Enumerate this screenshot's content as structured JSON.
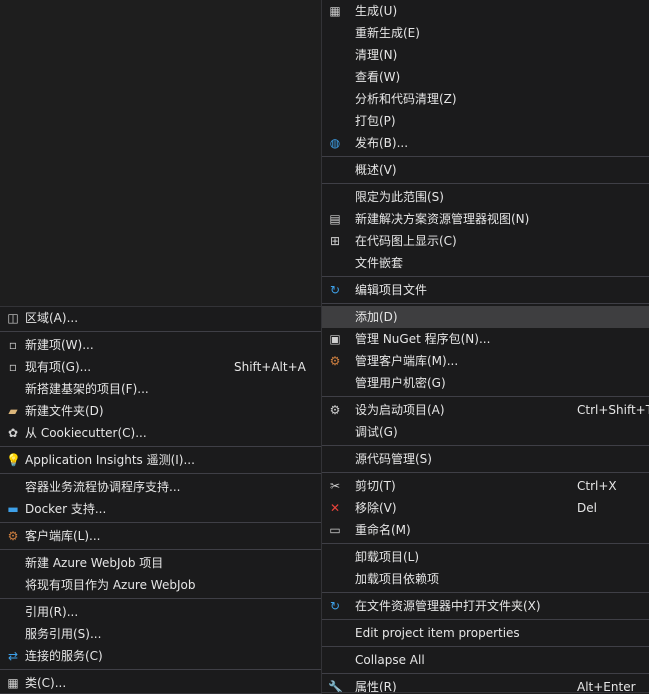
{
  "main_menu": {
    "items": [
      {
        "label": "生成(U)",
        "icon": "build-icon",
        "glyph": "▦",
        "color": "#c8c8c8"
      },
      {
        "label": "重新生成(E)"
      },
      {
        "label": "清理(N)"
      },
      {
        "label": "查看(W)"
      },
      {
        "label": "分析和代码清理(Z)"
      },
      {
        "label": "打包(P)"
      },
      {
        "label": "发布(B)...",
        "icon": "publish-globe-icon",
        "glyph": "◍",
        "color": "#3ea0e8"
      },
      {
        "sep": true
      },
      {
        "label": "概述(V)"
      },
      {
        "sep": true
      },
      {
        "label": "限定为此范围(S)"
      },
      {
        "label": "新建解决方案资源管理器视图(N)",
        "icon": "new-solution-explorer-view-icon",
        "glyph": "▤",
        "color": "#d0d0d0"
      },
      {
        "label": "在代码图上显示(C)",
        "icon": "code-map-icon",
        "glyph": "⊞",
        "color": "#d0d0d0"
      },
      {
        "label": "文件嵌套"
      },
      {
        "sep": true
      },
      {
        "label": "编辑项目文件",
        "icon": "edit-project-file-icon",
        "glyph": "↻",
        "color": "#3ea0e8"
      },
      {
        "sep": true
      },
      {
        "label": "添加(D)",
        "highlighted": true
      },
      {
        "label": "管理 NuGet 程序包(N)...",
        "icon": "nuget-package-icon",
        "glyph": "▣",
        "color": "#d0d0d0"
      },
      {
        "label": "管理客户端库(M)...",
        "icon": "client-library-icon",
        "glyph": "⚙",
        "color": "#d08040"
      },
      {
        "label": "管理用户机密(G)"
      },
      {
        "sep": true
      },
      {
        "label": "设为启动项目(A)",
        "icon": "startup-project-gear-icon",
        "glyph": "⚙",
        "color": "#d0d0d0",
        "shortcut": "Ctrl+Shift+T"
      },
      {
        "label": "调试(G)"
      },
      {
        "sep": true
      },
      {
        "label": "源代码管理(S)"
      },
      {
        "sep": true
      },
      {
        "label": "剪切(T)",
        "icon": "cut-scissors-icon",
        "glyph": "✂",
        "color": "#d0d0d0",
        "shortcut": "Ctrl+X"
      },
      {
        "label": "移除(V)",
        "icon": "remove-x-icon",
        "glyph": "✕",
        "color": "#e8433b",
        "shortcut": "Del"
      },
      {
        "label": "重命名(M)",
        "icon": "rename-icon",
        "glyph": "▭",
        "color": "#d0d0d0"
      },
      {
        "sep": true
      },
      {
        "label": "卸载项目(L)"
      },
      {
        "label": "加载项目依赖项"
      },
      {
        "sep": true
      },
      {
        "label": "在文件资源管理器中打开文件夹(X)",
        "icon": "open-folder-refresh-icon",
        "glyph": "↻",
        "color": "#3ea0e8"
      },
      {
        "sep": true
      },
      {
        "label": "Edit project item properties"
      },
      {
        "sep": true
      },
      {
        "label": "Collapse All"
      },
      {
        "sep": true
      },
      {
        "label": "属性(R)",
        "icon": "properties-wrench-icon",
        "glyph": "🔧",
        "color": "#d0d0d0",
        "shortcut": "Alt+Enter"
      }
    ]
  },
  "sub_menu": {
    "items": [
      {
        "label": "区域(A)...",
        "icon": "area-icon",
        "glyph": "◫",
        "color": "#d0d0d0"
      },
      {
        "sep": true
      },
      {
        "label": "新建项(W)...",
        "icon": "new-item-icon",
        "glyph": "▫",
        "color": "#d0d0d0"
      },
      {
        "label": "现有项(G)...",
        "icon": "existing-item-icon",
        "glyph": "▫",
        "color": "#d0d0d0",
        "shortcut": "Shift+Alt+A"
      },
      {
        "label": "新搭建基架的项目(F)..."
      },
      {
        "label": "新建文件夹(D)",
        "icon": "new-folder-icon",
        "glyph": "▰",
        "color": "#dcb67a"
      },
      {
        "label": "从 Cookiecutter(C)...",
        "icon": "cookiecutter-icon",
        "glyph": "✿",
        "color": "#d0d0d0"
      },
      {
        "sep": true
      },
      {
        "label": "Application Insights 遥测(I)...",
        "icon": "application-insights-bulb-icon",
        "glyph": "💡",
        "color": "#b07bd8"
      },
      {
        "sep": true
      },
      {
        "label": "容器业务流程协调程序支持..."
      },
      {
        "label": "Docker 支持...",
        "icon": "docker-icon",
        "glyph": "▬",
        "color": "#3ea0e8"
      },
      {
        "sep": true
      },
      {
        "label": "客户端库(L)...",
        "icon": "client-library-icon",
        "glyph": "⚙",
        "color": "#d08040"
      },
      {
        "sep": true
      },
      {
        "label": "新建 Azure WebJob 项目"
      },
      {
        "label": "将现有项目作为 Azure WebJob"
      },
      {
        "sep": true
      },
      {
        "label": "引用(R)..."
      },
      {
        "label": "服务引用(S)..."
      },
      {
        "label": "连接的服务(C)",
        "icon": "connected-service-icon",
        "glyph": "⇄",
        "color": "#3ea0e8"
      },
      {
        "sep": true
      },
      {
        "label": "类(C)...",
        "icon": "class-icon",
        "glyph": "▦",
        "color": "#d0d0d0"
      }
    ]
  }
}
